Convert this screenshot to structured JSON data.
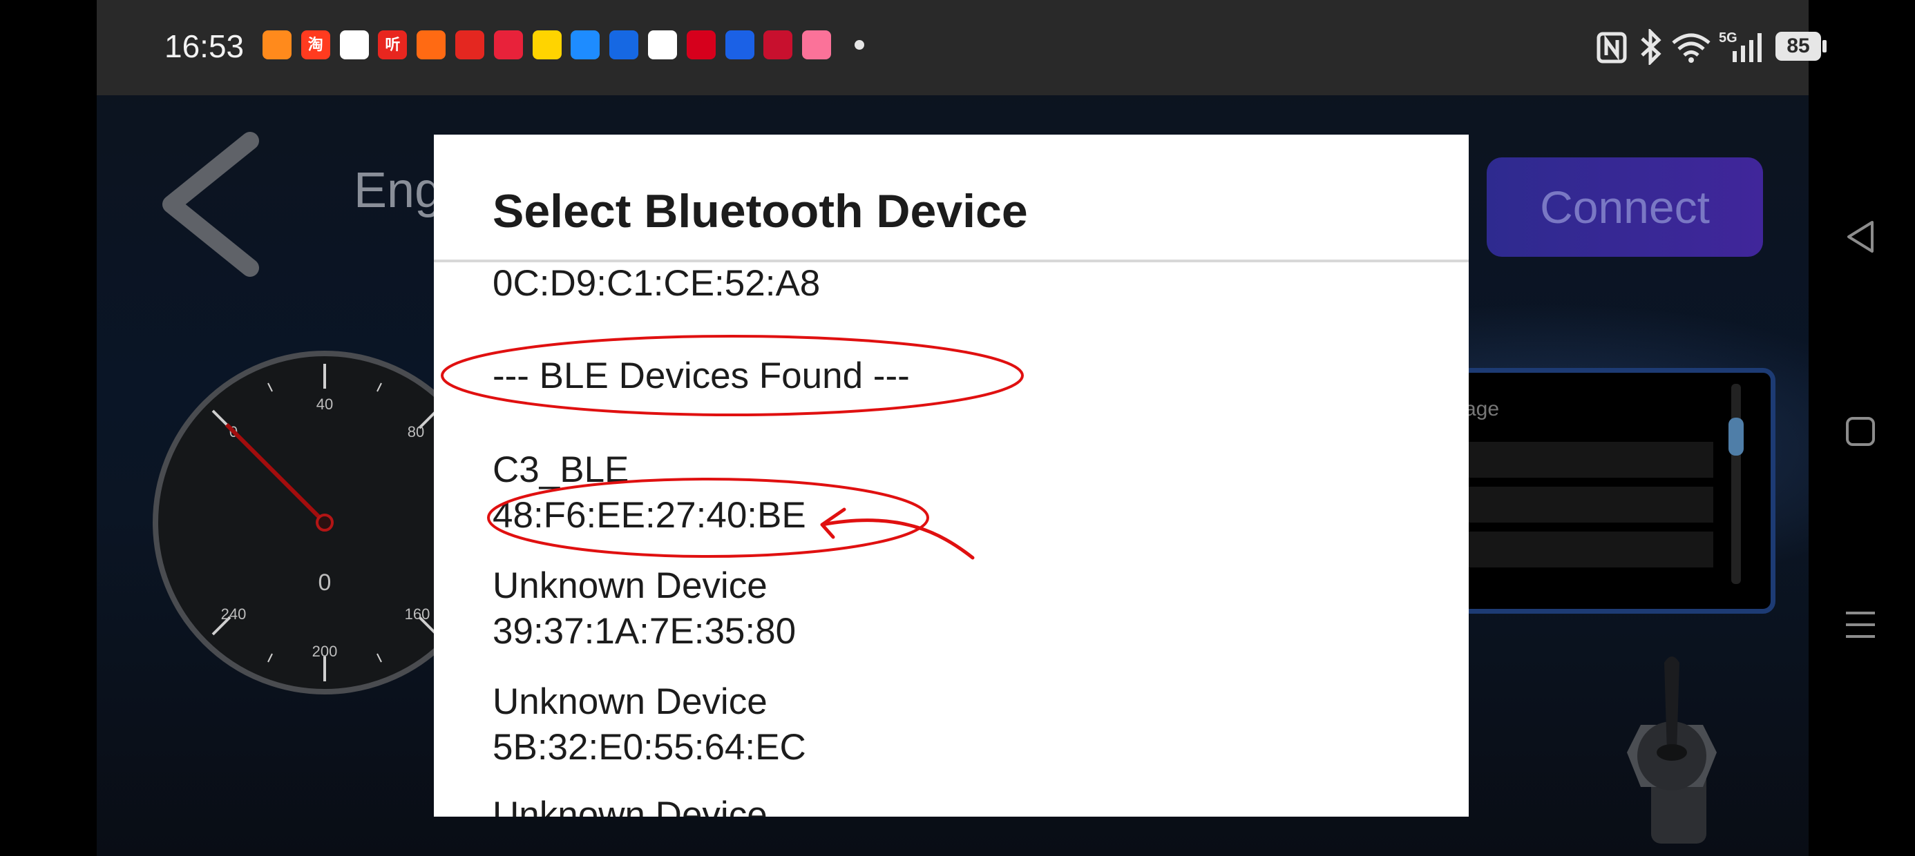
{
  "status_bar": {
    "time": "16:53",
    "battery": "85",
    "network": "5G",
    "notification_icons": [
      {
        "name": "app-icon-1",
        "color": "#ff8a1c"
      },
      {
        "name": "taobao-icon",
        "color": "#ff3b1f",
        "text": "淘"
      },
      {
        "name": "app-icon-3",
        "color": "#ffffff"
      },
      {
        "name": "ting-icon",
        "color": "#e8261f",
        "text": "听"
      },
      {
        "name": "app-icon-5",
        "color": "#ff6a13"
      },
      {
        "name": "app-icon-6",
        "color": "#e42720"
      },
      {
        "name": "app-icon-7",
        "color": "#e8223a"
      },
      {
        "name": "app-icon-8",
        "color": "#ffd400"
      },
      {
        "name": "app-icon-9",
        "color": "#1e8cff"
      },
      {
        "name": "app-icon-10",
        "color": "#1668e3"
      },
      {
        "name": "app-icon-11",
        "color": "#ffffff"
      },
      {
        "name": "cmb-icon",
        "color": "#d6001c"
      },
      {
        "name": "app-icon-13",
        "color": "#1b61e6"
      },
      {
        "name": "cmb-securities-icon",
        "color": "#c8102e"
      },
      {
        "name": "bilibili-icon",
        "color": "#fb7299"
      }
    ]
  },
  "background_app": {
    "title": "Eng",
    "connect_label": "Connect",
    "message_label": "age",
    "gauge": {
      "center_value": "0",
      "tick_labels": [
        "40",
        "80",
        "240",
        "160",
        "200",
        "0"
      ]
    }
  },
  "dialog": {
    "title": "Select Bluetooth Device",
    "lines": [
      {
        "text": "0C:D9:C1:CE:52:A8"
      },
      {
        "text": "--- BLE Devices Found ---"
      },
      {
        "text": "C3_BLE"
      },
      {
        "text": "48:F6:EE:27:40:BE"
      },
      {
        "text": "Unknown Device"
      },
      {
        "text": "39:37:1A:7E:35:80"
      },
      {
        "text": "Unknown Device"
      },
      {
        "text": "5B:32:E0:55:64:EC"
      },
      {
        "text": "Unknown Device"
      }
    ]
  },
  "colors": {
    "annotation": "#e01010",
    "dialog_bg": "#ffffff",
    "connect_button": "#3a2896"
  }
}
